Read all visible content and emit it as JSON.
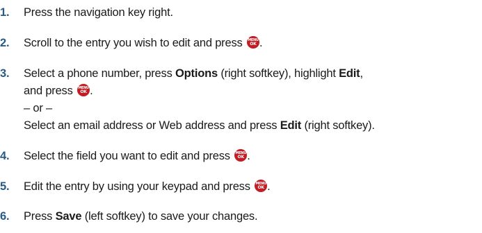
{
  "steps": [
    {
      "num": "1.",
      "text": "Press the navigation key right."
    },
    {
      "num": "2.",
      "text": "Scroll to the entry you wish to edit and press"
    },
    {
      "num": "3.",
      "p1": "Select a phone number, press ",
      "options": "Options",
      "p2": " (right softkey), highlight ",
      "edit": "Edit",
      "p3": ",",
      "p4": "and press",
      "or": "– or –",
      "p5": "Select an email address or Web address and press ",
      "edit2": "Edit",
      "p6": " (right softkey)."
    },
    {
      "num": "4.",
      "text": "Select the field you want to edit and press"
    },
    {
      "num": "5.",
      "text": "Edit the entry by using your keypad and press"
    },
    {
      "num": "6.",
      "p1": "Press ",
      "save": "Save",
      "p2": " (left softkey) to save your changes."
    }
  ],
  "menu_key": {
    "top": "MENU",
    "bottom": "OK",
    "icon": "menu-ok-key-icon",
    "color": "#c21d24"
  },
  "step_number_color": "#2a5a86"
}
